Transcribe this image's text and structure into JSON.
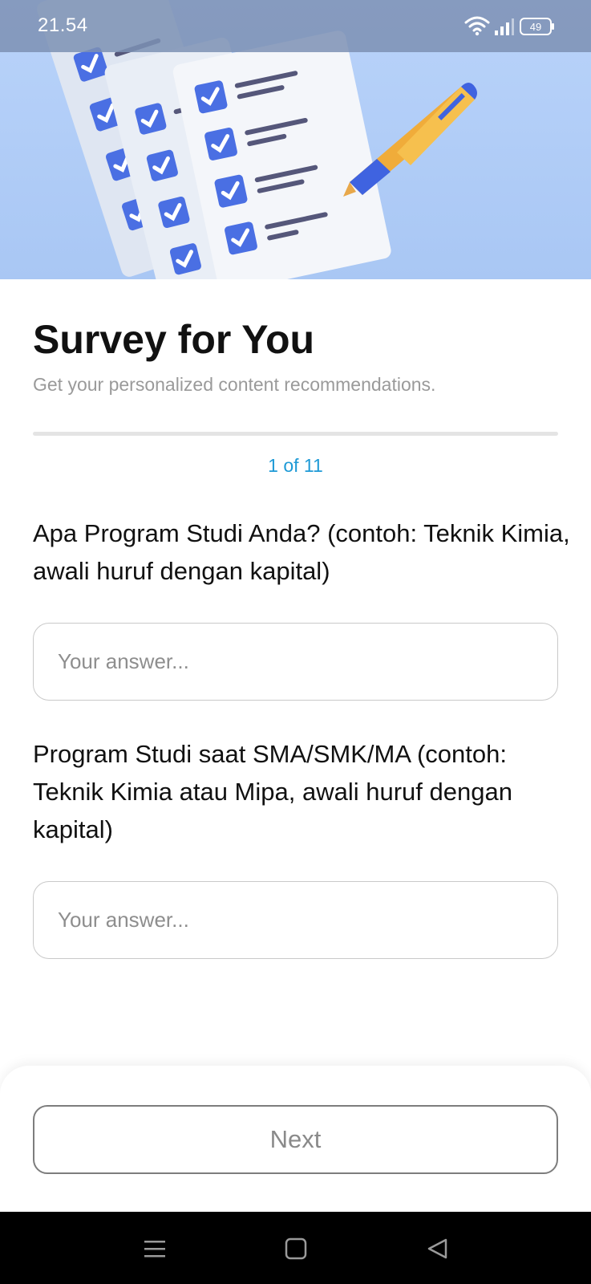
{
  "status_bar": {
    "time": "21.54",
    "battery": "49"
  },
  "header": {
    "title": "Survey for You",
    "subtitle": "Get your personalized content recommendations."
  },
  "progress": {
    "label": "1 of 11",
    "current": 1,
    "total": 11,
    "fraction": 0.0
  },
  "questions": [
    {
      "text": "Apa Program Studi Anda? (contoh: Teknik Kimia, awali huruf dengan kapital)",
      "placeholder": "Your answer..."
    },
    {
      "text": "Program Studi saat SMA/SMK/MA (contoh: Teknik Kimia atau Mipa, awali huruf dengan kapital)",
      "placeholder": "Your answer..."
    }
  ],
  "footer": {
    "next_label": "Next"
  },
  "colors": {
    "accent": "#1e9ad6",
    "hero_bg": "#b4cff8",
    "checkbox": "#4a6fe3"
  },
  "icons": [
    "wifi-icon",
    "signal-icon",
    "battery-icon",
    "menu-icon",
    "home-icon",
    "back-icon"
  ]
}
